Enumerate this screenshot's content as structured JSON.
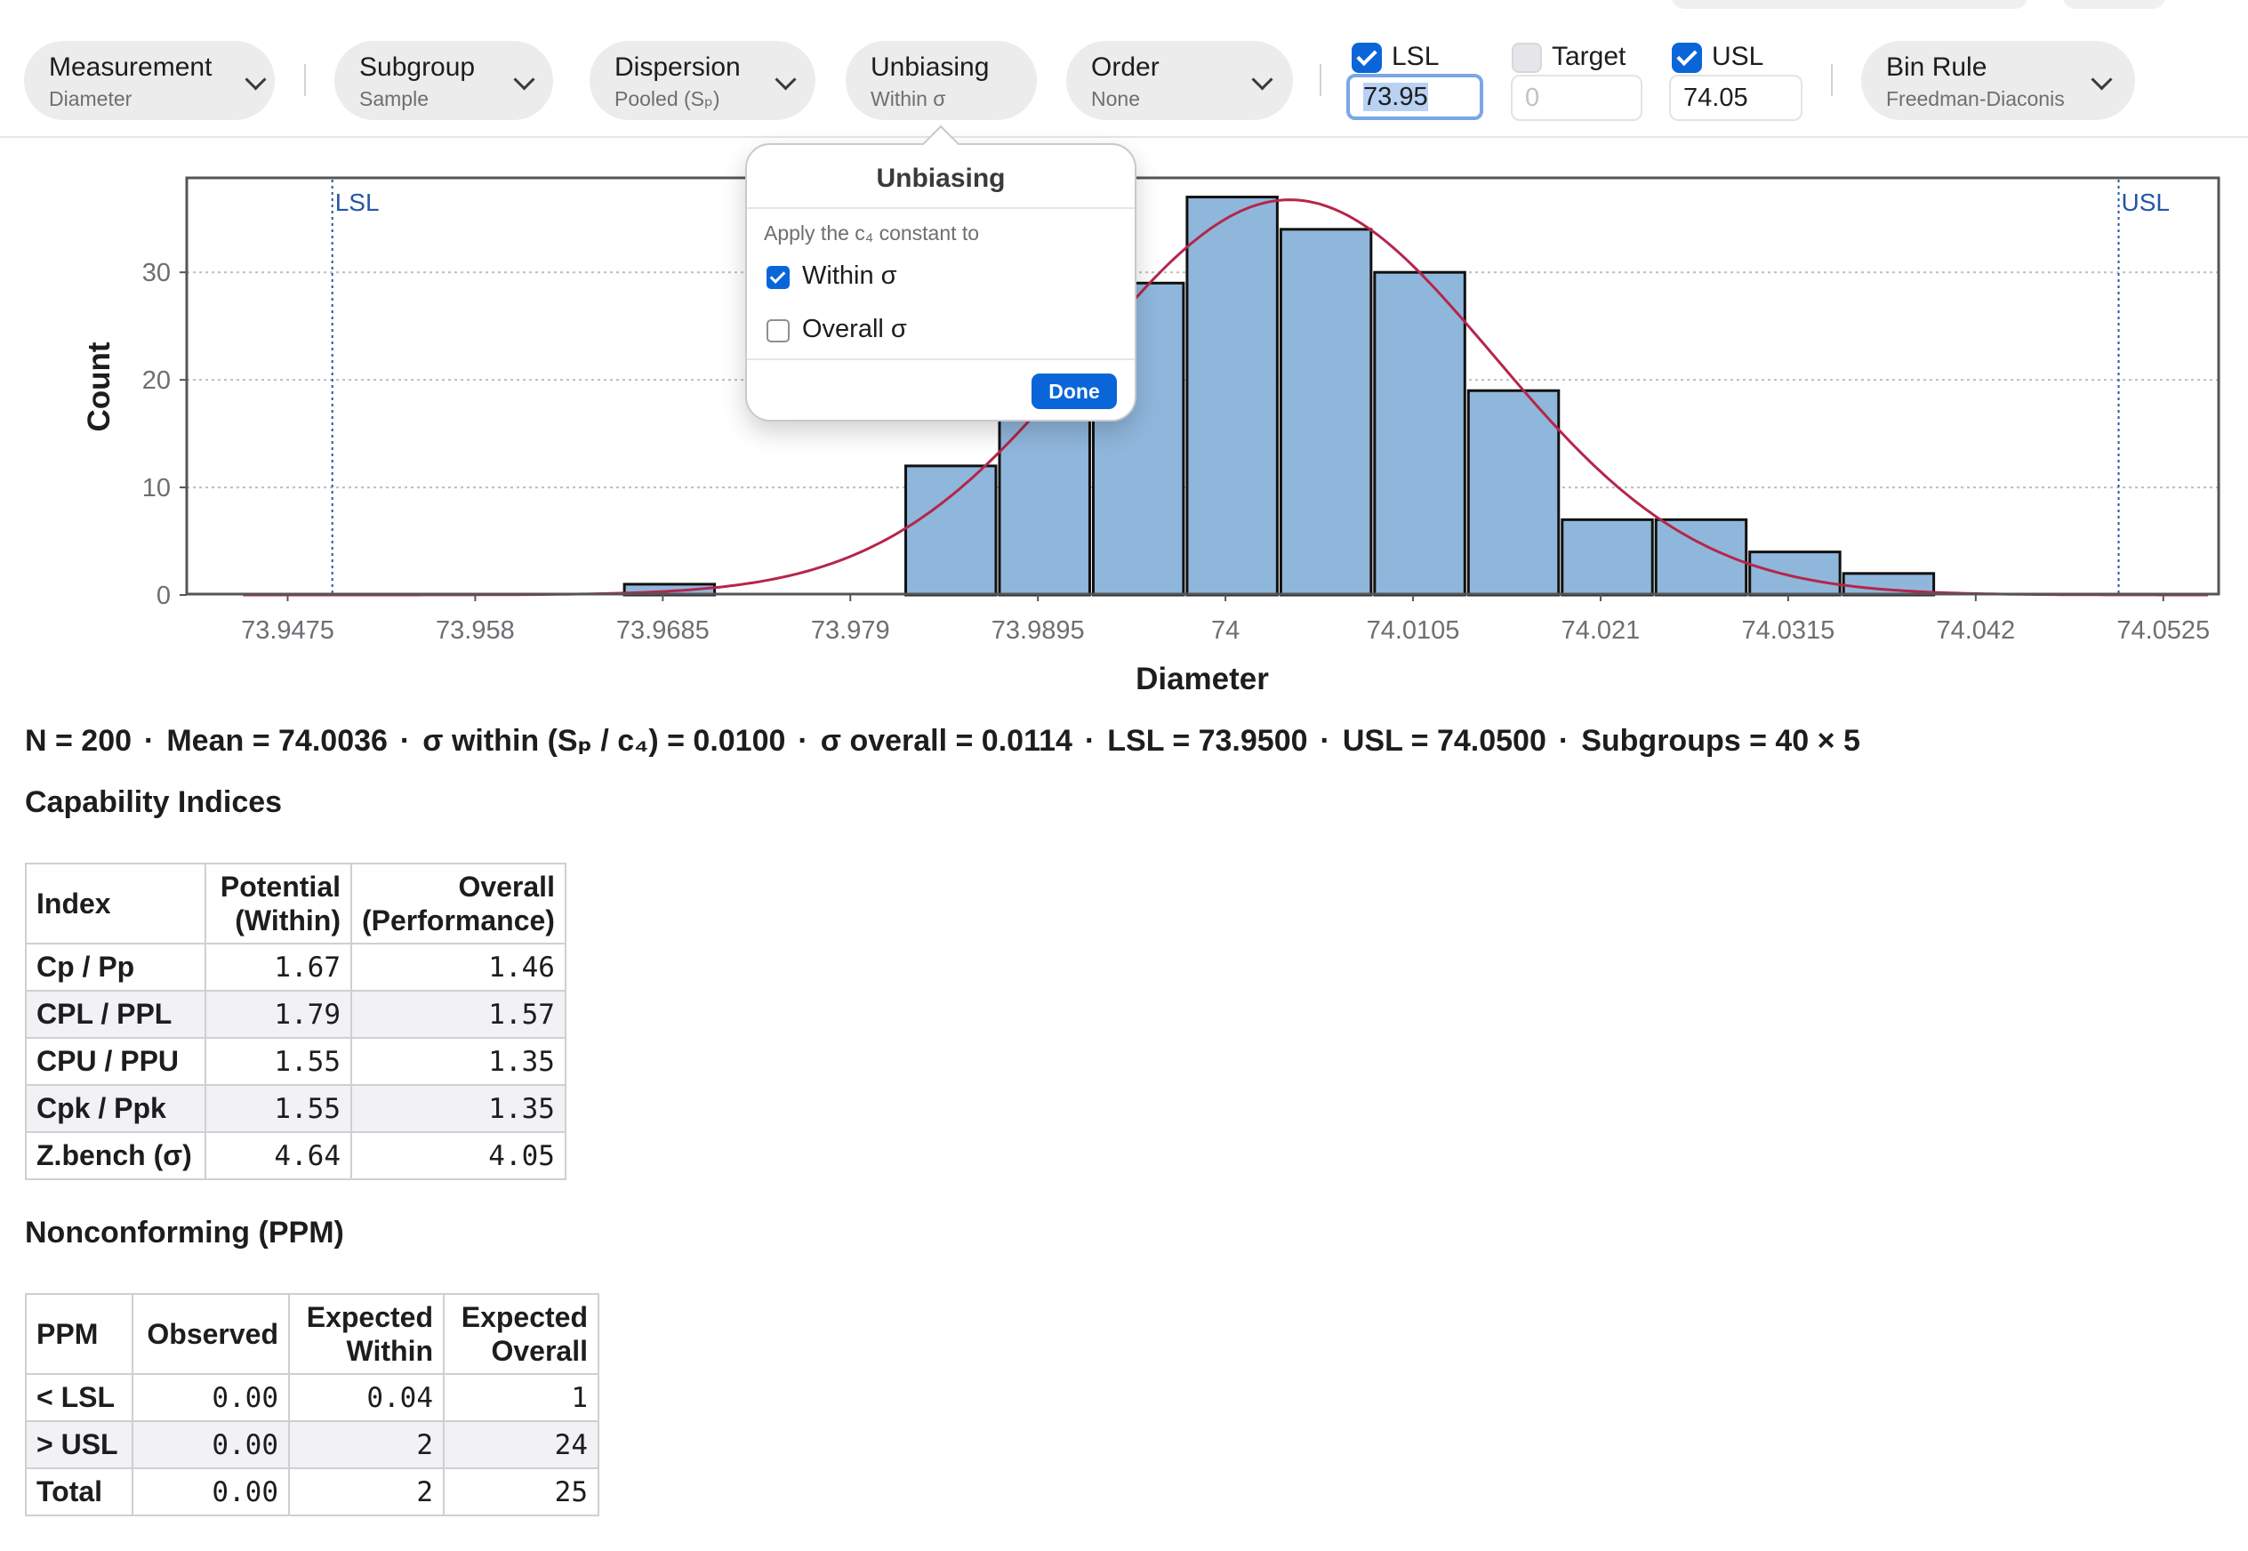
{
  "toolbar": {
    "measurement": {
      "label": "Measurement",
      "value": "Diameter"
    },
    "subgroup": {
      "label": "Subgroup",
      "value": "Sample"
    },
    "dispersion": {
      "label": "Dispersion",
      "value": "Pooled (Sₚ)"
    },
    "unbiasing": {
      "label": "Unbiasing",
      "value": "Within σ"
    },
    "order": {
      "label": "Order",
      "value": "None"
    },
    "lsl": {
      "label": "LSL",
      "checked": true,
      "value": "73.95"
    },
    "target": {
      "label": "Target",
      "checked": false,
      "placeholder": "0"
    },
    "usl": {
      "label": "USL",
      "checked": true,
      "value": "74.05"
    },
    "bin_rule": {
      "label": "Bin Rule",
      "value": "Freedman-Diaconis"
    }
  },
  "popover": {
    "title": "Unbiasing",
    "hint": "Apply the c₄ constant to",
    "options": [
      {
        "label": "Within σ",
        "checked": true
      },
      {
        "label": "Overall σ",
        "checked": false
      }
    ],
    "done_label": "Done"
  },
  "chart_data": {
    "type": "bar",
    "title": "",
    "xlabel": "Diameter",
    "ylabel": "Count",
    "x_ticks": [
      "73.9475",
      "73.958",
      "73.9685",
      "73.979",
      "73.9895",
      "74",
      "74.0105",
      "74.021",
      "74.0315",
      "74.042",
      "74.0525"
    ],
    "y_ticks": [
      "0",
      "10",
      "20",
      "30"
    ],
    "xlim": [
      73.942,
      74.0555
    ],
    "ylim": [
      0,
      38.7
    ],
    "bin_width": 0.00525,
    "bins": [
      {
        "start": 73.96625,
        "count": 1
      },
      {
        "start": 73.982,
        "count": 12
      },
      {
        "start": 73.98725,
        "count": 22
      },
      {
        "start": 73.9925,
        "count": 29
      },
      {
        "start": 73.99775,
        "count": 37
      },
      {
        "start": 74.003,
        "count": 34
      },
      {
        "start": 74.00825,
        "count": 30
      },
      {
        "start": 74.0135,
        "count": 19
      },
      {
        "start": 74.01875,
        "count": 7
      },
      {
        "start": 74.024,
        "count": 7
      },
      {
        "start": 74.02925,
        "count": 4
      },
      {
        "start": 74.0345,
        "count": 2
      }
    ],
    "normal_curve": {
      "mean": 74.0036,
      "sigma": 0.0114,
      "n": 200,
      "x_from": 73.945,
      "x_to": 74.055
    },
    "spec_lines": [
      {
        "label": "LSL",
        "x": 73.95
      },
      {
        "label": "USL",
        "x": 74.05
      }
    ],
    "grid": true,
    "colors": {
      "bar": "#8fb7dc",
      "bar_edge": "#111111",
      "curve": "#b5264a",
      "spec": "#2456a4"
    }
  },
  "summary": {
    "n": "N = 200",
    "mean": "Mean = 74.0036",
    "sigma_within": "σ within (Sₚ / c₄) = 0.0100",
    "sigma_overall": "σ overall = 0.0114",
    "lsl": "LSL = 73.9500",
    "usl": "USL = 74.0500",
    "subgroups": "Subgroups = 40 × 5",
    "sep": "·"
  },
  "capability": {
    "title": "Capability Indices",
    "headers": [
      "Index",
      "Potential (Within)",
      "Overall (Performance)"
    ],
    "rows": [
      [
        "Cp / Pp",
        "1.67",
        "1.46"
      ],
      [
        "CPL / PPL",
        "1.79",
        "1.57"
      ],
      [
        "CPU / PPU",
        "1.55",
        "1.35"
      ],
      [
        "Cpk / Ppk",
        "1.55",
        "1.35"
      ],
      [
        "Z.bench (σ)",
        "4.64",
        "4.05"
      ]
    ]
  },
  "ppm": {
    "title": "Nonconforming (PPM)",
    "headers": [
      "PPM",
      "Observed",
      "Expected Within",
      "Expected Overall"
    ],
    "rows": [
      [
        "< LSL",
        "0.00",
        "0.04",
        "1"
      ],
      [
        "> USL",
        "0.00",
        "2",
        "24"
      ],
      [
        "Total",
        "0.00",
        "2",
        "25"
      ]
    ]
  }
}
